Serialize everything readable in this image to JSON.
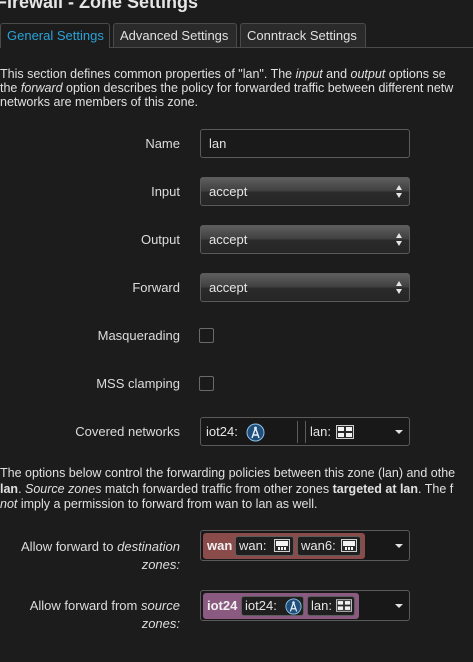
{
  "page": {
    "title": "Firewall - Zone Settings"
  },
  "tabs": [
    {
      "label": "General Settings",
      "active": true
    },
    {
      "label": "Advanced Settings",
      "active": false
    },
    {
      "label": "Conntrack Settings",
      "active": false
    }
  ],
  "description": {
    "line1_a": "This section defines common properties of \"lan\". The ",
    "line1_input": "input",
    "line1_b": " and ",
    "line1_output": "output",
    "line1_c": " options se",
    "line2_a": "the ",
    "line2_forward": "forward",
    "line2_b": " option describes the policy for forwarded traffic between different netw",
    "line3": "networks are members of this zone."
  },
  "form": {
    "name": {
      "label": "Name",
      "value": "lan"
    },
    "input": {
      "label": "Input",
      "value": "accept"
    },
    "output": {
      "label": "Output",
      "value": "accept"
    },
    "forward": {
      "label": "Forward",
      "value": "accept"
    },
    "masquerading": {
      "label": "Masquerading",
      "checked": false
    },
    "mss_clamping": {
      "label": "MSS clamping",
      "checked": false
    },
    "covered_networks": {
      "label": "Covered networks",
      "items": [
        {
          "name": "iot24:",
          "icon": "wireless-icon"
        },
        {
          "name": "lan:",
          "icon": "ethernet-ports-icon"
        }
      ]
    }
  },
  "forwarding_description": {
    "line1": "The options below control the forwarding policies between this zone (lan) and othe",
    "line2_a": "lan",
    "line2_b": ". ",
    "line2_c": "Source zones",
    "line2_d": " match forwarded traffic from other zones ",
    "line2_e": "targeted at lan",
    "line2_f": ". The f",
    "line3_a": "not",
    "line3_b": " imply a permission to forward from wan to lan as well."
  },
  "forward_dest": {
    "label_a": "Allow forward to ",
    "label_b": "destination",
    "label_c": "zones:",
    "zone": "wan",
    "zone_color": "#8a4b4b",
    "networks": [
      {
        "name": "wan:",
        "icon": "ethernet-icon"
      },
      {
        "name": "wan6:",
        "icon": "ethernet-icon"
      }
    ]
  },
  "forward_src": {
    "label_a": "Allow forward from ",
    "label_b": "source",
    "label_c": "zones:",
    "zone": "iot24",
    "zone_color": "#8a5a80",
    "networks": [
      {
        "name": "iot24:",
        "icon": "wireless-icon"
      },
      {
        "name": "lan:",
        "icon": "ethernet-ports-icon"
      }
    ]
  },
  "colors": {
    "accent": "#2aa2d8",
    "background": "#1c1c1c"
  }
}
